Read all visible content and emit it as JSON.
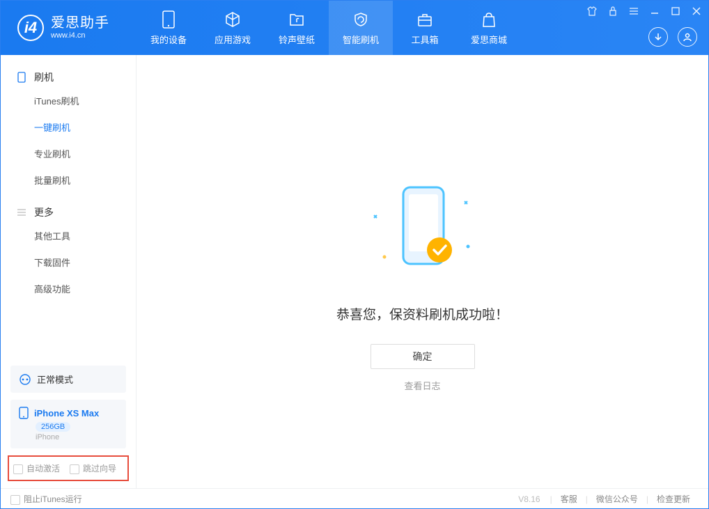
{
  "app": {
    "name": "爱思助手",
    "url": "www.i4.cn"
  },
  "nav": {
    "device": "我的设备",
    "apps": "应用游戏",
    "ringwall": "铃声壁纸",
    "flash": "智能刷机",
    "toolbox": "工具箱",
    "store": "爱思商城"
  },
  "sidebar": {
    "group1": "刷机",
    "items1": [
      "iTunes刷机",
      "一键刷机",
      "专业刷机",
      "批量刷机"
    ],
    "group2": "更多",
    "items2": [
      "其他工具",
      "下载固件",
      "高级功能"
    ],
    "status": "正常模式",
    "device": {
      "name": "iPhone XS Max",
      "storage": "256GB",
      "type": "iPhone"
    },
    "opt_auto_activate": "自动激活",
    "opt_skip_guide": "跳过向导"
  },
  "content": {
    "success_msg": "恭喜您，保资料刷机成功啦！",
    "ok": "确定",
    "view_log": "查看日志"
  },
  "footer": {
    "block_itunes": "阻止iTunes运行",
    "version": "V8.16",
    "service": "客服",
    "wechat": "微信公众号",
    "update": "检查更新"
  }
}
